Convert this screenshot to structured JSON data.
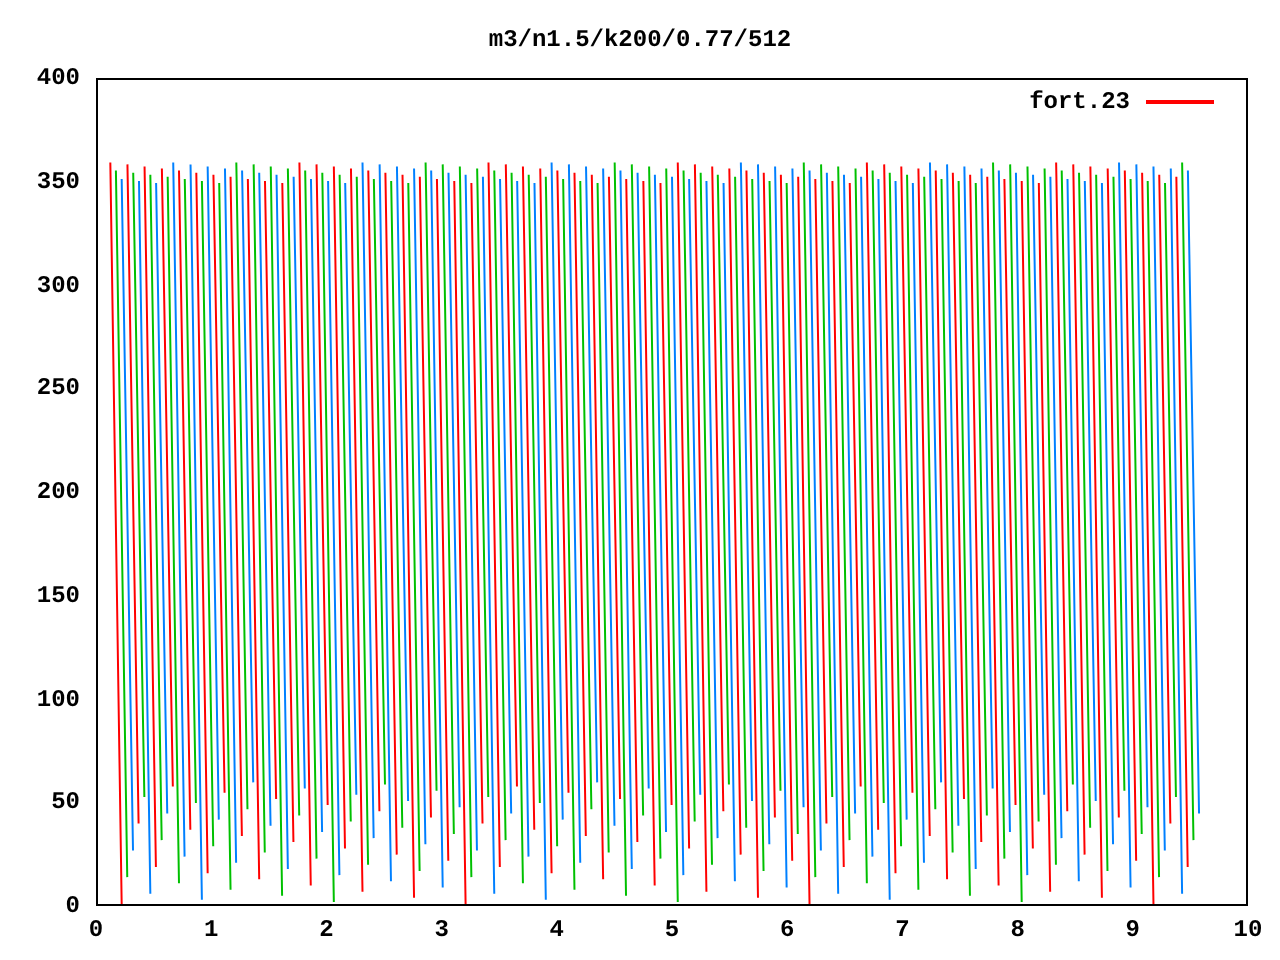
{
  "title": "m3/n1.5/k200/0.77/512",
  "legend": {
    "label": "fort.23",
    "color": "#ff0000"
  },
  "y_ticks": [
    "400",
    "350",
    "300",
    "250",
    "200",
    "150",
    "100",
    "50",
    "0"
  ],
  "x_ticks": [
    "0",
    "1",
    "2",
    "3",
    "4",
    "5",
    "6",
    "7",
    "8",
    "9",
    "10"
  ]
}
